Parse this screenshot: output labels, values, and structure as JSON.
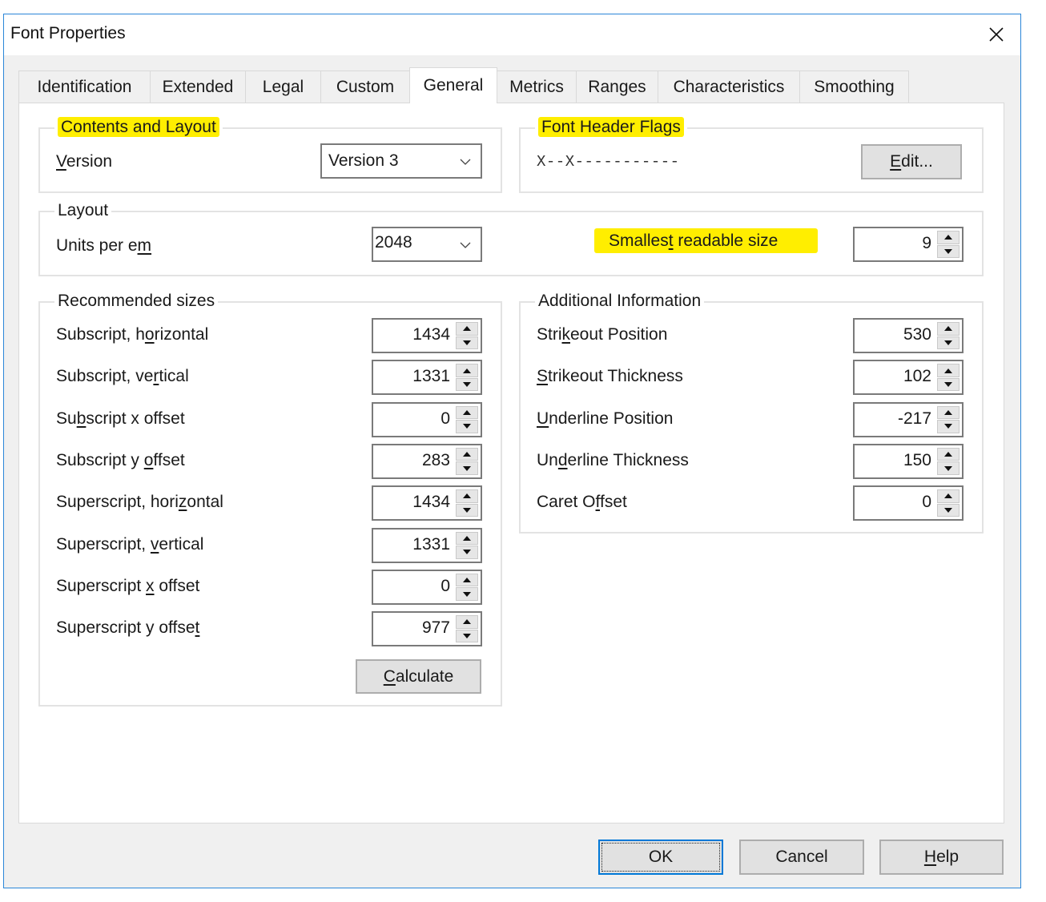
{
  "window": {
    "title": "Font Properties",
    "close_icon": "close-icon"
  },
  "tabs": [
    {
      "label": "Identification",
      "active": false
    },
    {
      "label": "Extended",
      "active": false
    },
    {
      "label": "Legal",
      "active": false
    },
    {
      "label": "Custom",
      "active": false
    },
    {
      "label": "General",
      "active": true
    },
    {
      "label": "Metrics",
      "active": false
    },
    {
      "label": "Ranges",
      "active": false
    },
    {
      "label": "Characteristics",
      "active": false
    },
    {
      "label": "Smoothing",
      "active": false
    }
  ],
  "contents_layout": {
    "group_label": "Contents and Layout",
    "version_label_pre": "",
    "version_label_u": "V",
    "version_label_post": "ersion",
    "version_value": "Version 3",
    "highlight_color": "#ffee00"
  },
  "font_header_flags": {
    "group_label": "Font Header Flags",
    "flags": "X--X-----------",
    "edit_button_u": "E",
    "edit_button_post": "dit..."
  },
  "layout": {
    "group_label": "Layout",
    "units_label_pre": "Units per e",
    "units_label_u": "m",
    "units_value": "2048",
    "smallest_label_pre": "Smalles",
    "smallest_label_u": "t",
    "smallest_label_post": " readable size",
    "smallest_value": "9"
  },
  "recommended_sizes": {
    "group_label": "Recommended sizes",
    "rows": [
      {
        "pre": "Subscript, h",
        "u": "o",
        "post": "rizontal",
        "value": "1434"
      },
      {
        "pre": "Subscript, ve",
        "u": "r",
        "post": "tical",
        "value": "1331"
      },
      {
        "pre": "Su",
        "u": "b",
        "post": "script x offset",
        "value": "0"
      },
      {
        "pre": "Subscript y ",
        "u": "o",
        "post": "ffset",
        "value": "283"
      },
      {
        "pre": "Superscript, hori",
        "u": "z",
        "post": "ontal",
        "value": "1434"
      },
      {
        "pre": "Superscript, ",
        "u": "v",
        "post": "ertical",
        "value": "1331"
      },
      {
        "pre": "Superscript ",
        "u": "x",
        "post": " offset",
        "value": "0"
      },
      {
        "pre": "Superscript y offse",
        "u": "t",
        "post": "",
        "value": "977"
      }
    ],
    "calculate_u": "C",
    "calculate_post": "alculate"
  },
  "additional_info": {
    "group_label": "Additional Information",
    "rows": [
      {
        "pre": "Stri",
        "u": "k",
        "post": "eout Position",
        "value": "530"
      },
      {
        "pre": "",
        "u": "S",
        "post": "trikeout Thickness",
        "value": "102"
      },
      {
        "pre": "",
        "u": "U",
        "post": "nderline Position",
        "value": "-217"
      },
      {
        "pre": "Un",
        "u": "d",
        "post": "erline Thickness",
        "value": "150"
      },
      {
        "pre": "Caret O",
        "u": "f",
        "post": "fset",
        "value": "0"
      }
    ]
  },
  "footer": {
    "ok_label": "OK",
    "cancel_label": "Cancel",
    "help_u": "H",
    "help_post": "elp"
  }
}
